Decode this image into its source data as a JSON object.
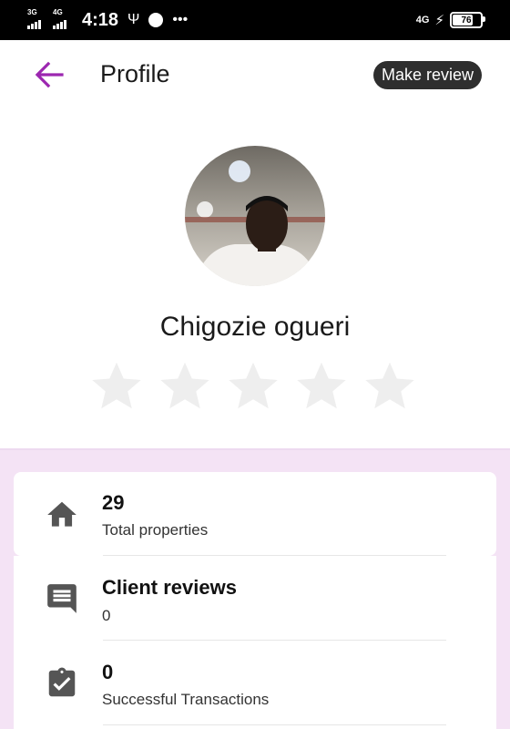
{
  "status_bar": {
    "network_1": "3G",
    "network_2": "4G",
    "time": "4:18",
    "network_right": "4G",
    "battery": "76"
  },
  "app_bar": {
    "title": "Profile",
    "review_button": "Make review"
  },
  "profile": {
    "name": "Chigozie ogueri",
    "rating": 0,
    "max_rating": 5
  },
  "stats": [
    {
      "value": "29",
      "label": "Total properties",
      "icon": "home-icon"
    },
    {
      "value": "Client reviews",
      "label": "0",
      "icon": "comment-icon"
    },
    {
      "value": "0",
      "label": "Successful Transactions",
      "icon": "clipboard-check-icon"
    }
  ],
  "colors": {
    "accent": "#9c27b0",
    "stats_background": "#f4e3f5",
    "star_empty": "#eeeeee",
    "button_dark": "#2e2e2e"
  }
}
